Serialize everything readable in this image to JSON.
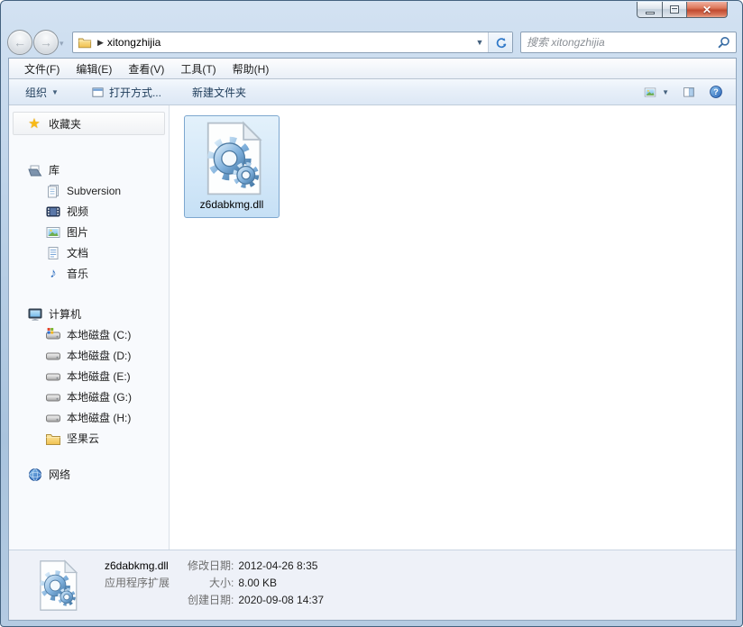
{
  "titlebar": {
    "buttons": {
      "minimize": "minimize",
      "maximize": "maximize",
      "close": "close"
    }
  },
  "navbar": {
    "address": {
      "path": "xitongzhijia"
    },
    "search": {
      "placeholder": "搜索 xitongzhijia"
    }
  },
  "menubar": {
    "items": [
      {
        "label": "文件(F)"
      },
      {
        "label": "编辑(E)"
      },
      {
        "label": "查看(V)"
      },
      {
        "label": "工具(T)"
      },
      {
        "label": "帮助(H)"
      }
    ]
  },
  "toolbar": {
    "organize_label": "组织",
    "open_with_label": "打开方式...",
    "new_folder_label": "新建文件夹"
  },
  "sidebar": {
    "favorites": {
      "label": "收藏夹"
    },
    "libraries": {
      "label": "库",
      "items": [
        {
          "label": "Subversion",
          "icon": "library-icon"
        },
        {
          "label": "视频",
          "icon": "videos-icon"
        },
        {
          "label": "图片",
          "icon": "pictures-icon"
        },
        {
          "label": "文档",
          "icon": "documents-icon"
        },
        {
          "label": "音乐",
          "icon": "music-icon"
        }
      ]
    },
    "computer": {
      "label": "计算机",
      "items": [
        {
          "label": "本地磁盘 (C:)",
          "icon": "system-drive-icon"
        },
        {
          "label": "本地磁盘 (D:)",
          "icon": "drive-icon"
        },
        {
          "label": "本地磁盘 (E:)",
          "icon": "drive-icon"
        },
        {
          "label": "本地磁盘 (G:)",
          "icon": "drive-icon"
        },
        {
          "label": "本地磁盘 (H:)",
          "icon": "drive-icon"
        },
        {
          "label": "坚果云",
          "icon": "folder-icon"
        }
      ]
    },
    "network": {
      "label": "网络"
    }
  },
  "main": {
    "files": [
      {
        "name": "z6dabkmg.dll",
        "icon": "dll-file-icon",
        "selected": true
      }
    ]
  },
  "details": {
    "name": "z6dabkmg.dll",
    "type": "应用程序扩展",
    "props": [
      {
        "label": "修改日期:",
        "value": "2012-04-26 8:35"
      },
      {
        "label": "大小:",
        "value": "8.00 KB"
      },
      {
        "label": "创建日期:",
        "value": "2020-09-08 14:37"
      }
    ]
  },
  "colors": {
    "selection_border": "#7da7cf",
    "selection_background": "#d2e7f8",
    "close_button_red": "#c14a30",
    "frame_blue": "#b4cbe2"
  }
}
